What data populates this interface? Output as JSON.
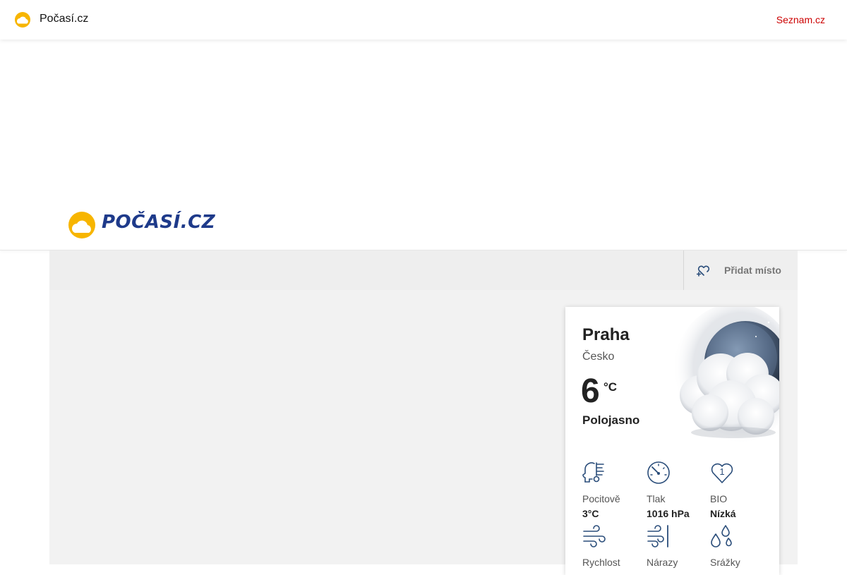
{
  "topbar": {
    "site_name": "Počasí.cz",
    "seznam_link": "Seznam.cz"
  },
  "header": {
    "logo_text": "POČASÍ.CZ"
  },
  "nav": {
    "add_place_label": "Přidat místo"
  },
  "weather": {
    "city": "Praha",
    "country": "Česko",
    "temperature": "6",
    "unit": "°C",
    "condition": "Polojasno",
    "metrics": [
      {
        "label": "Pocitově",
        "value": "3°C",
        "icon": "feels-like-icon"
      },
      {
        "label": "Tlak",
        "value": "1016 hPa",
        "icon": "pressure-gauge-icon"
      },
      {
        "label": "BIO",
        "value": "Nízká",
        "icon": "bio-heart-icon",
        "icon_text": "1"
      },
      {
        "label": "Rychlost",
        "value": "",
        "icon": "wind-speed-icon"
      },
      {
        "label": "Nárazy",
        "value": "",
        "icon": "wind-gusts-icon"
      },
      {
        "label": "Srážky",
        "value": "",
        "icon": "precipitation-icon"
      }
    ]
  },
  "colors": {
    "brand_yellow": "#f7b500",
    "brand_blue": "#1e3a8a",
    "link_red": "#cc0000",
    "icon_blue": "#2a4d7a"
  }
}
